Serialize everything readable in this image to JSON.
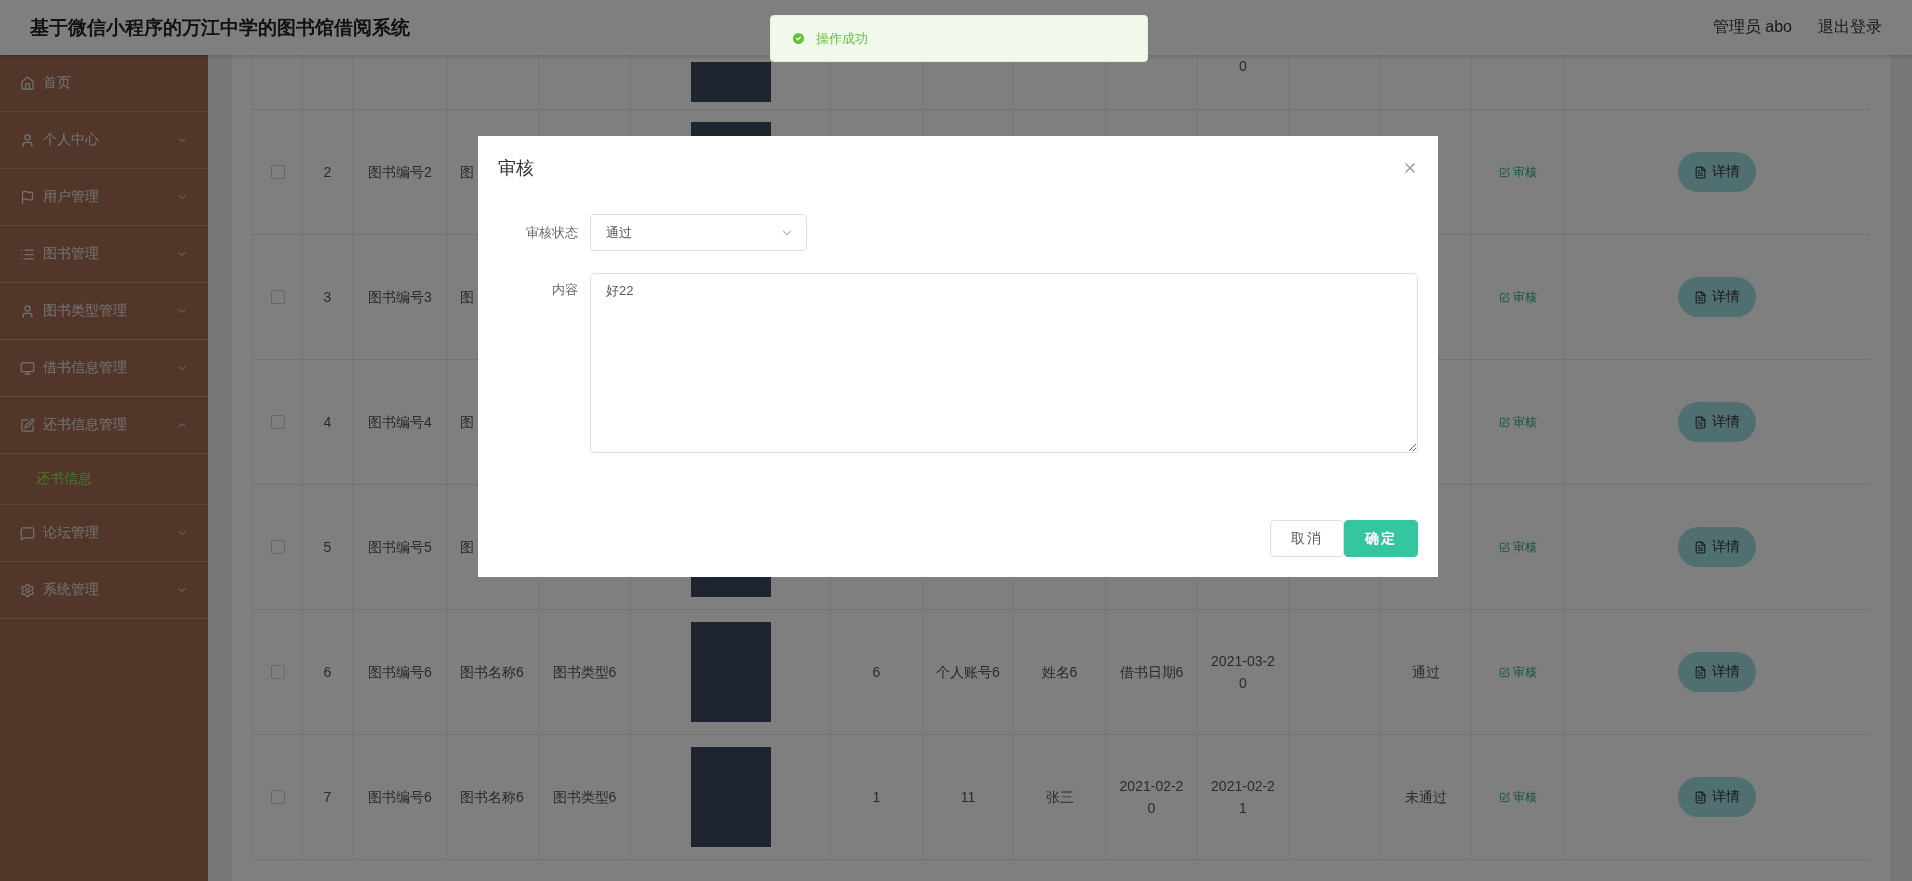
{
  "header": {
    "title": "基于微信小程序的万江中学的图书馆借阅系统",
    "user": "管理员 abo",
    "logout": "退出登录"
  },
  "sidebar": {
    "items": [
      {
        "label": "首页"
      },
      {
        "label": "个人中心",
        "expanded": false
      },
      {
        "label": "用户管理",
        "expanded": false
      },
      {
        "label": "图书管理",
        "expanded": false
      },
      {
        "label": "图书类型管理",
        "expanded": false
      },
      {
        "label": "借书信息管理",
        "expanded": false
      },
      {
        "label": "还书信息管理",
        "expanded": true,
        "children": [
          {
            "label": "还书信息",
            "selected": true
          }
        ]
      },
      {
        "label": "论坛管理",
        "expanded": false
      },
      {
        "label": "系统管理",
        "expanded": false
      }
    ]
  },
  "table": {
    "rows": [
      {
        "kind": "cut",
        "return_date": "0"
      },
      {
        "kind": "full",
        "checked": false,
        "index": "2",
        "book_code": "图书编号2",
        "book_name": "图",
        "review_link": "审核",
        "details_button": "详情"
      },
      {
        "kind": "full",
        "checked": false,
        "index": "3",
        "book_code": "图书编号3",
        "book_name": "图",
        "review_link": "审核",
        "details_button": "详情"
      },
      {
        "kind": "full",
        "checked": false,
        "index": "4",
        "book_code": "图书编号4",
        "book_name": "图",
        "review_link": "审核",
        "details_button": "详情"
      },
      {
        "kind": "full",
        "checked": false,
        "index": "5",
        "book_code": "图书编号5",
        "book_name": "图",
        "review_link": "审核",
        "details_button": "详情"
      },
      {
        "kind": "full",
        "checked": false,
        "index": "6",
        "book_code": "图书编号6",
        "book_name": "图书名称6",
        "book_type": "图书类型6",
        "quantity": "6",
        "account": "个人账号6",
        "name": "姓名6",
        "borrow_date": "借书日期6",
        "return_date": "2021-03-20",
        "review_status": "通过",
        "review_link": "审核",
        "details_button": "详情"
      },
      {
        "kind": "full",
        "checked": false,
        "index": "7",
        "book_code": "图书编号6",
        "book_name": "图书名称6",
        "book_type": "图书类型6",
        "quantity": "1",
        "account": "11",
        "name": "张三",
        "borrow_date": "2021-02-20",
        "return_date": "2021-02-21",
        "review_status": "未通过",
        "review_link": "审核",
        "details_button": "详情"
      }
    ]
  },
  "dialog": {
    "title": "审核",
    "fields": [
      {
        "kind": "select",
        "label": "审核状态",
        "value": "通过"
      },
      {
        "kind": "textarea",
        "label": "内容",
        "value": "好22"
      }
    ],
    "buttons": [
      {
        "kind": "default",
        "label": "取消"
      },
      {
        "kind": "primary",
        "label": "确定"
      }
    ]
  },
  "toast": {
    "kind": "success",
    "text": "操作成功"
  }
}
